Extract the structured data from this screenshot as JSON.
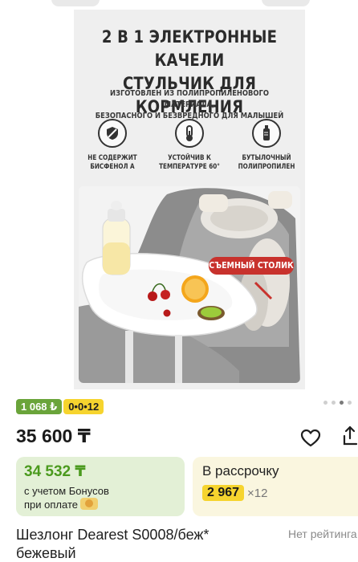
{
  "banner": {
    "title_line1": "2 В 1 ЭЛЕКТРОННЫЕ КАЧЕЛИ",
    "title_line2": "СТУЛЬЧИК ДЛЯ КОРМЛЕНИЯ",
    "subtitle_line1": "ИЗГОТОВЛЕН ИЗ ПОЛИПРОПИЛЕНОВОГО МАТЕРИАЛА,",
    "subtitle_line2": "БЕЗОПАСНОГО И БЕЗВРЕДНОГО ДЛЯ МАЛЫШЕЙ",
    "features": [
      {
        "icon": "shield-icon",
        "line1": "НЕ СОДЕРЖИТ",
        "line2": "БИСФЕНОЛ А"
      },
      {
        "icon": "thermometer-icon",
        "line1": "УСТОЙЧИВ К",
        "line2": "ТЕМПЕРАТУРЕ 60°"
      },
      {
        "icon": "bottle-icon",
        "line1": "БУТЫЛОЧНЫЙ",
        "line2": "ПОЛИПРОПИЛЕН"
      }
    ],
    "removable_label": "СЪЕМНЫЙ СТОЛИК"
  },
  "badges": {
    "rating_value": "1 068 ₺",
    "installment_plan": "0•0•12"
  },
  "gallery": {
    "dots": 4,
    "active_index": 2
  },
  "price": "35 600 ₸",
  "bonus": {
    "price": "34 532 ₸",
    "line1": "с учетом Бонусов",
    "line2": "при оплате"
  },
  "installment": {
    "title": "В рассрочку",
    "amount": "2 967",
    "multiplier": "×12"
  },
  "product": {
    "title_line1": "Шезлонг Dearest S0008/беж*",
    "title_line2": "бежевый",
    "rating_status": "Нет рейтинга"
  },
  "colors": {
    "bonus_green": "#4b9a1e",
    "badge_green": "#6aa43a",
    "badge_yellow": "#f6d42e",
    "removable_red": "#c8322d"
  }
}
